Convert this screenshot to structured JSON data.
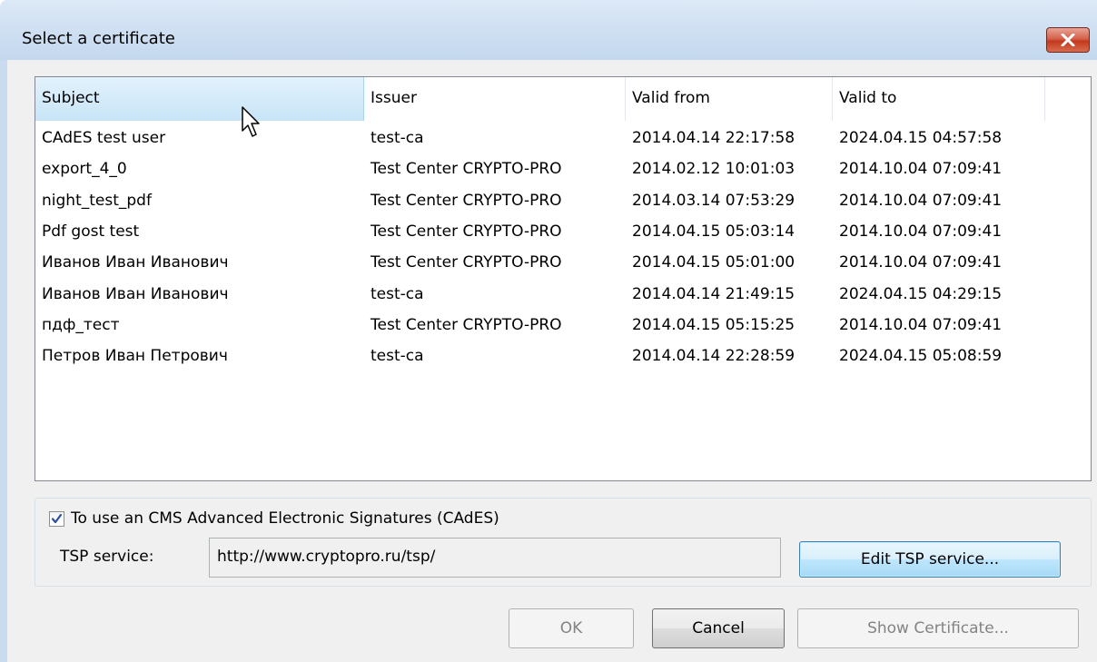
{
  "window": {
    "title": "Select a certificate",
    "close_icon": "close-x-icon"
  },
  "list": {
    "columns": [
      "Subject",
      "Issuer",
      "Valid from",
      "Valid to"
    ],
    "rows": [
      {
        "subject": "CAdES test user",
        "issuer": "test-ca",
        "valid_from": "2014.04.14 22:17:58",
        "valid_to": "2024.04.15 04:57:58"
      },
      {
        "subject": "export_4_0",
        "issuer": "Test Center CRYPTO-PRO",
        "valid_from": "2014.02.12 10:01:03",
        "valid_to": "2014.10.04 07:09:41"
      },
      {
        "subject": "night_test_pdf",
        "issuer": "Test Center CRYPTO-PRO",
        "valid_from": "2014.03.14 07:53:29",
        "valid_to": "2014.10.04 07:09:41"
      },
      {
        "subject": "Pdf gost test",
        "issuer": "Test Center CRYPTO-PRO",
        "valid_from": "2014.04.15 05:03:14",
        "valid_to": "2014.10.04 07:09:41"
      },
      {
        "subject": "Иванов Иван Иванович",
        "issuer": "Test Center CRYPTO-PRO",
        "valid_from": "2014.04.15 05:01:00",
        "valid_to": "2014.10.04 07:09:41"
      },
      {
        "subject": "Иванов Иван Иванович",
        "issuer": "test-ca",
        "valid_from": "2014.04.14 21:49:15",
        "valid_to": "2024.04.15 04:29:15"
      },
      {
        "subject": "пдф_тест",
        "issuer": "Test Center CRYPTO-PRO",
        "valid_from": "2014.04.15 05:15:25",
        "valid_to": "2014.10.04 07:09:41"
      },
      {
        "subject": "Петров Иван Петрович",
        "issuer": "test-ca",
        "valid_from": "2014.04.14 22:28:59",
        "valid_to": "2024.04.15 05:08:59"
      }
    ]
  },
  "cades": {
    "checked": true,
    "checkbox_label": "To use an CMS Advanced Electronic Signatures (CAdES)",
    "tsp_label": "TSP service:",
    "tsp_value": "http://www.cryptopro.ru/tsp/",
    "edit_button": "Edit TSP service..."
  },
  "buttons": {
    "ok": "OK",
    "cancel": "Cancel",
    "show_certificate": "Show Certificate..."
  },
  "colors": {
    "title_bar": "#c9dbef",
    "close_button": "#c2391d",
    "header_hot": "#c7e4f7"
  }
}
